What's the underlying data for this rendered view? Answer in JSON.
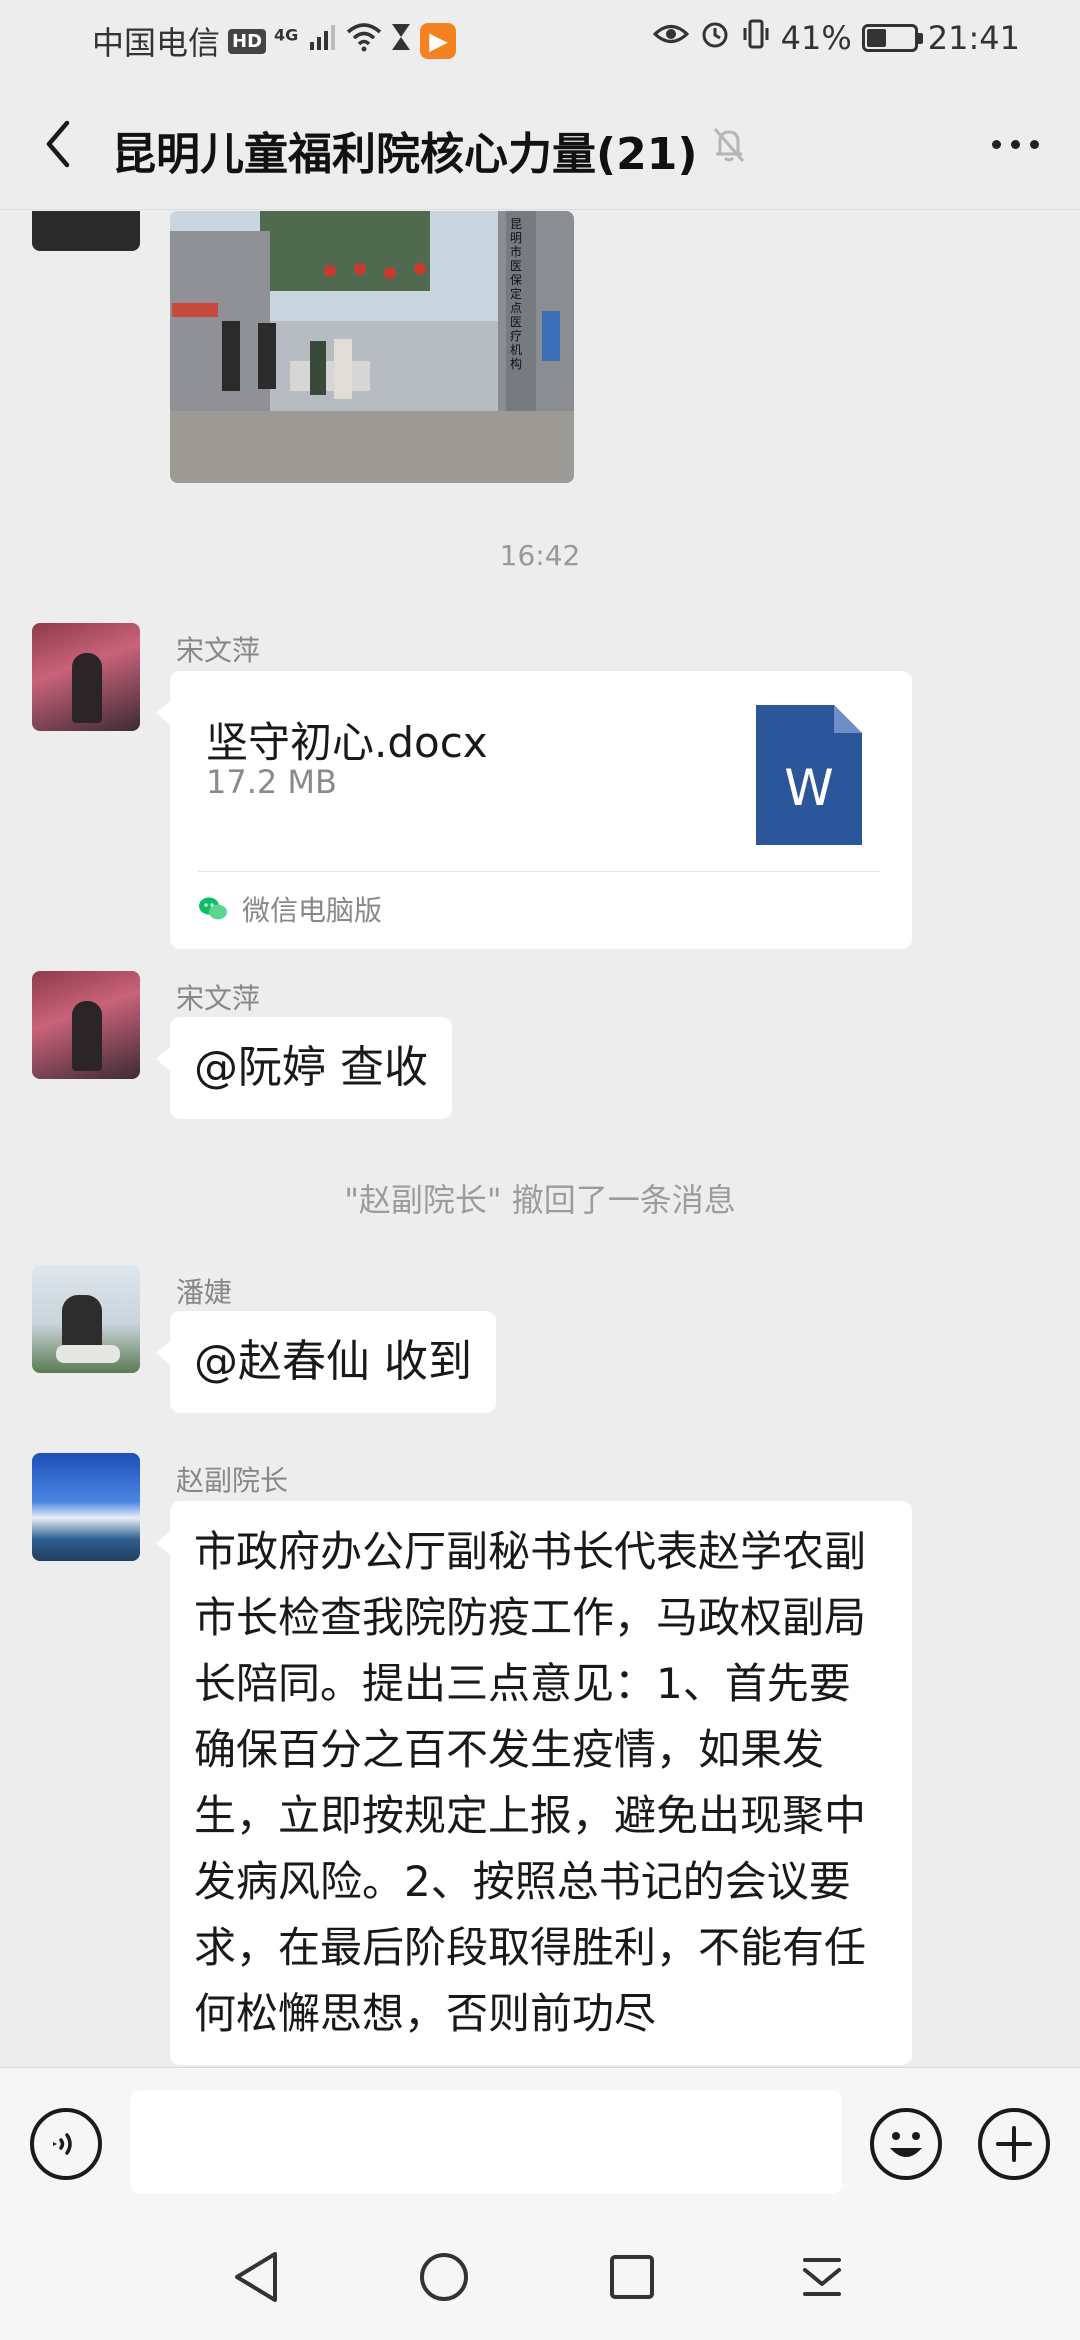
{
  "status_bar": {
    "carrier": "中国电信",
    "hd": "HD",
    "network": "4G",
    "battery_percent": "41%",
    "battery_level": 0.41,
    "time": "21:41"
  },
  "header": {
    "title": "昆明儿童福利院核心力量(21)"
  },
  "photo": {
    "sign_text": "昆明市医保定点医疗机构"
  },
  "messages": {
    "timestamp": "16:42",
    "file": {
      "sender": "宋文萍",
      "file_name": "坚守初心.docx",
      "file_size": "17.2 MB",
      "file_badge": "W",
      "source": "微信电脑版"
    },
    "reply1": {
      "sender": "宋文萍",
      "text": "@阮婷  查收"
    },
    "recall": "\"赵副院长\" 撤回了一条消息",
    "reply2": {
      "sender": "潘婕",
      "text": "@赵春仙  收到"
    },
    "long": {
      "sender": "赵副院长",
      "text": "市政府办公厅副秘书长代表赵学农副市长检查我院防疫工作，马政权副局长陪同。提出三点意见：1、首先要确保百分之百不发生疫情，如果发生，立即按规定上报，避免出现聚中发病风险。2、按照总书记的会议要求，在最后阶段取得胜利，不能有任何松懈思想，否则前功尽"
    }
  },
  "input": {
    "placeholder": ""
  },
  "colors": {
    "background": "#ededed",
    "bubble": "#ffffff",
    "word_blue": "#2b579a",
    "wechat_green": "#07c160"
  }
}
